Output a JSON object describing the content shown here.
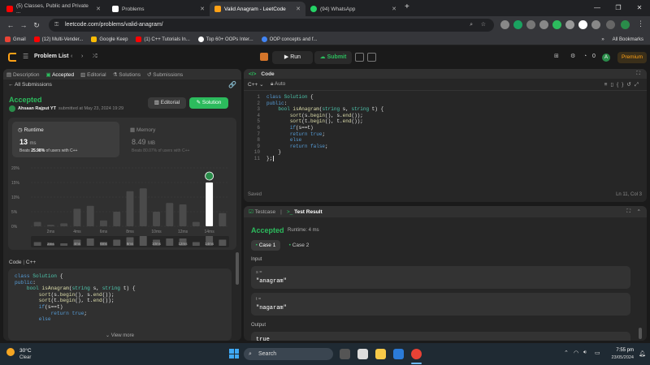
{
  "browser": {
    "tabs": [
      {
        "label": "(5) Classes, Public and Private ...",
        "icon_color": "#ff0000",
        "active": false
      },
      {
        "label": "Problems",
        "icon_color": "#ffffff",
        "active": false
      },
      {
        "label": "Valid Anagram - LeetCode",
        "icon_color": "#ffa116",
        "active": true
      },
      {
        "label": "(94) WhatsApp",
        "icon_color": "#25d366",
        "active": false
      }
    ],
    "new_tab": "+",
    "url": "leetcode.com/problems/valid-anagram/",
    "bookmarks": [
      {
        "label": "Gmail",
        "color": "#ea4335"
      },
      {
        "label": "(12) Multi-Vender...",
        "color": "#ff0000"
      },
      {
        "label": "Google Keep",
        "color": "#fbbc04"
      },
      {
        "label": "(1) C++ Tutorials In...",
        "color": "#ff0000"
      },
      {
        "label": "Top 60+ OOPs Inter...",
        "color": "#ffffff"
      },
      {
        "label": "OOP concepts and f...",
        "color": "#4285f4"
      }
    ],
    "bookmarks_more": "»",
    "all_bookmarks": "All Bookmarks"
  },
  "lc": {
    "problem_list": "Problem List",
    "run": "Run",
    "submit": "Submit",
    "streak": "0",
    "premium": "Premium",
    "avatar_letter": "A"
  },
  "left": {
    "tabs": [
      "Description",
      "Accepted",
      "Editorial",
      "Solutions",
      "Submissions"
    ],
    "all_submissions": "All Submissions",
    "status": "Accepted",
    "user": "Ahsaan Rajput YT",
    "submitted": "submitted at May 23, 2024 19:29",
    "editorial_btn": "Editorial",
    "solution_btn": "Solution",
    "runtime_label": "Runtime",
    "runtime_value": "13",
    "runtime_unit": "ms",
    "beats_runtime_prefix": "Beats",
    "beats_runtime_pct": "25.98%",
    "beats_runtime_suffix": "of users with C++",
    "memory_label": "Memory",
    "memory_value": "8.49",
    "memory_unit": "MB",
    "beats_memory": "Beats 80.07% of users with C++",
    "yticks": [
      "20%",
      "15%",
      "10%",
      "5%",
      "0%"
    ],
    "xticks": [
      "2ms",
      "4ms",
      "6ms",
      "8ms",
      "10ms",
      "12ms",
      "14ms"
    ],
    "bar_pct": [
      1.5,
      0.5,
      1,
      6,
      7,
      2,
      5,
      12,
      13,
      5,
      8,
      7.5,
      1.5,
      15,
      4.5
    ],
    "mini_pct": [
      3,
      2,
      2,
      5,
      6,
      3,
      5,
      7,
      8,
      5,
      6,
      6,
      3,
      8,
      5
    ],
    "highlight_index": 13,
    "code_label": "Code",
    "code_lang": "C++",
    "code_lines": [
      "class Solution {",
      "public:",
      "    bool isAnagram(string s, string t) {",
      "        sort(s.begin(), s.end());",
      "        sort(t.begin(), t.end());",
      "        if(s==t)",
      "            return true;",
      "        else"
    ],
    "view_more": "View more"
  },
  "editor": {
    "title": "Code",
    "lang": "C++",
    "auto": "Auto",
    "lines": [
      "class Solution {",
      "public:",
      "    bool isAnagram(string s, string t) {",
      "        sort(s.begin(), s.end());",
      "        sort(t.begin(), t.end());",
      "        if(s==t)",
      "        return true;",
      "        else",
      "        return false;",
      "    }",
      "};"
    ],
    "saved": "Saved",
    "cursor": "Ln 11, Col 3"
  },
  "result": {
    "tab_testcase": "Testcase",
    "tab_result": "Test Result",
    "status": "Accepted",
    "runtime": "Runtime: 4 ms",
    "case1": "Case 1",
    "case2": "Case 2",
    "input_label": "Input",
    "s_label": "s =",
    "s_value": "\"anagram\"",
    "t_label": "t =",
    "t_value": "\"nagaram\"",
    "output_label": "Output",
    "output_value": "true"
  },
  "taskbar": {
    "temp": "30°C",
    "weather": "Clear",
    "search": "Search",
    "lang": "ENG",
    "lang2": "IN",
    "time": "7:55 pm",
    "date": "23/05/2024"
  },
  "colors": {
    "accent_green": "#2cbb5d",
    "accent_orange": "#ffa116",
    "keyword": "#569cd6",
    "type": "#4ec9b0",
    "func": "#dcdcaa"
  }
}
